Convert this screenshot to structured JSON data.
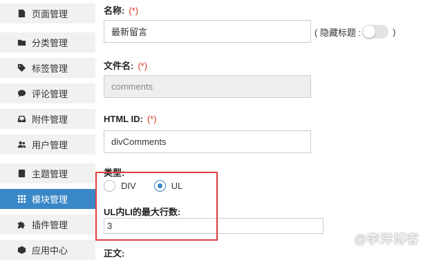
{
  "sidebar": {
    "items": [
      {
        "label": "页面管理",
        "icon": "page-icon",
        "active": false
      },
      {
        "label": "分类管理",
        "icon": "folder-icon",
        "active": false
      },
      {
        "label": "标签管理",
        "icon": "tag-icon",
        "active": false
      },
      {
        "label": "评论管理",
        "icon": "comment-icon",
        "active": false
      },
      {
        "label": "附件管理",
        "icon": "inbox-icon",
        "active": false
      },
      {
        "label": "用户管理",
        "icon": "users-icon",
        "active": false
      },
      {
        "label": "主题管理",
        "icon": "theme-icon",
        "active": false
      },
      {
        "label": "模块管理",
        "icon": "grid-icon",
        "active": true
      },
      {
        "label": "插件管理",
        "icon": "puzzle-icon",
        "active": false
      },
      {
        "label": "应用中心",
        "icon": "cube-icon",
        "active": false
      }
    ]
  },
  "form": {
    "name_label": "名称:",
    "name_required": "(*)",
    "name_value": "最新留言",
    "hide_title_label": "( 隐藏标题 :",
    "hide_title_close": ")",
    "hide_title_on": false,
    "filename_label": "文件名:",
    "filename_required": "(*)",
    "filename_value": "comments",
    "htmlid_label": "HTML ID:",
    "htmlid_required": "(*)",
    "htmlid_value": "divComments",
    "type_label": "类型:",
    "type_options": [
      "DIV",
      "UL"
    ],
    "type_selected": "UL",
    "ul_max_label": "UL内LI的最大行数:",
    "ul_max_value": "3",
    "content_label": "正文:"
  },
  "watermark": "@李洋博客",
  "colors": {
    "accent": "#3a87c8",
    "required": "#d6331a",
    "highlight_box": "#e03c3c",
    "sidebar_bg": "#f1f1f1"
  }
}
